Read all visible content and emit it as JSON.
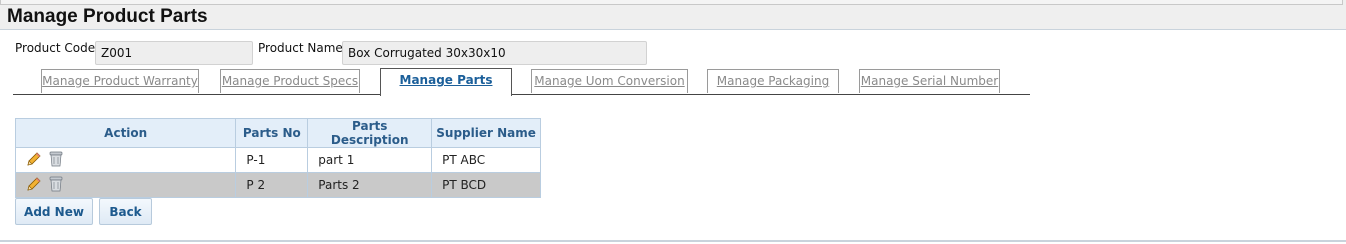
{
  "page": {
    "title": "Manage Product Parts"
  },
  "form": {
    "product_code_label": "Product Code",
    "product_code_value": "Z001",
    "product_name_label": "Product Name",
    "product_name_value": "Box Corrugated 30x30x10"
  },
  "tabs": [
    {
      "label": "Manage Product Warranty",
      "active": false
    },
    {
      "label": "Manage Product Specs",
      "active": false
    },
    {
      "label": "Manage Parts",
      "active": true
    },
    {
      "label": "Manage Uom Conversion",
      "active": false
    },
    {
      "label": "Manage Packaging",
      "active": false
    },
    {
      "label": "Manage Serial Number",
      "active": false
    }
  ],
  "table": {
    "headers": [
      "Action",
      "Parts No",
      "Parts Description",
      "Supplier Name"
    ],
    "rows": [
      {
        "parts_no": "P-1",
        "description": "part 1",
        "supplier": "PT ABC",
        "actions": [
          "edit-pencil-icon",
          "delete-trash-icon"
        ]
      },
      {
        "parts_no": "P 2",
        "description": "Parts 2",
        "supplier": "PT BCD",
        "actions": [
          "edit-pencil-icon",
          "delete-trash-icon"
        ]
      }
    ]
  },
  "buttons": {
    "add_new": "Add New",
    "back": "Back"
  },
  "colors": {
    "link_blue": "#1b5f9a",
    "header_bg": "#e3eef9",
    "selected_row": "#c9c9c9"
  }
}
